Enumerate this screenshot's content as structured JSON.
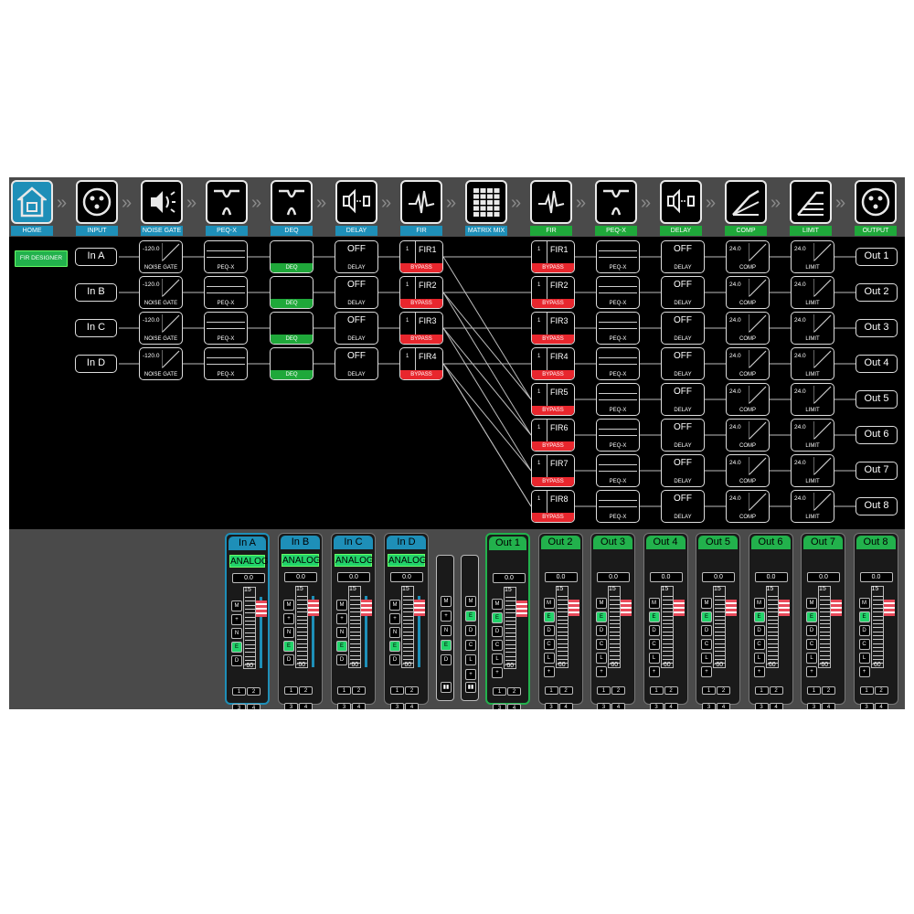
{
  "toolbar": {
    "items": [
      {
        "label": "HOME",
        "icon": "home-icon",
        "color": "blue"
      },
      {
        "label": "INPUT",
        "icon": "xlr-input-icon",
        "color": "blue"
      },
      {
        "label": "NOISE GATE",
        "icon": "speaker-icon",
        "color": "blue"
      },
      {
        "label": "PEQ-X",
        "icon": "peq-x-icon",
        "color": "blue"
      },
      {
        "label": "DEQ",
        "icon": "deq-icon",
        "color": "blue"
      },
      {
        "label": "DELAY",
        "icon": "delay-icon",
        "color": "blue"
      },
      {
        "label": "FIR",
        "icon": "fir-icon",
        "color": "blue"
      },
      {
        "label": "MATRIX MIX",
        "icon": "matrix-icon",
        "color": "blue"
      },
      {
        "label": "FIR",
        "icon": "fir-icon",
        "color": "green"
      },
      {
        "label": "PEQ-X",
        "icon": "peq-x-icon",
        "color": "green"
      },
      {
        "label": "DELAY",
        "icon": "delay-icon",
        "color": "green"
      },
      {
        "label": "COMP",
        "icon": "comp-icon",
        "color": "green"
      },
      {
        "label": "LIMIT",
        "icon": "limit-icon",
        "color": "green"
      },
      {
        "label": "OUTPUT",
        "icon": "xlr-output-icon",
        "color": "green"
      }
    ]
  },
  "fir_designer": "FIR DESIGNER",
  "inputs": [
    {
      "name": "In A",
      "gate": "-120.0",
      "gate_label": "NOISE GATE",
      "peq_label": "PEQ-X",
      "deq_label": "DEQ",
      "delay": "OFF",
      "delay_label": "DELAY",
      "fir": "FIR1",
      "fir_num": "1",
      "fir_label": "BYPASS"
    },
    {
      "name": "In B",
      "gate": "-120.0",
      "gate_label": "NOISE GATE",
      "peq_label": "PEQ-X",
      "deq_label": "DEQ",
      "delay": "OFF",
      "delay_label": "DELAY",
      "fir": "FIR2",
      "fir_num": "1",
      "fir_label": "BYPASS"
    },
    {
      "name": "In C",
      "gate": "-120.0",
      "gate_label": "NOISE GATE",
      "peq_label": "PEQ-X",
      "deq_label": "DEQ",
      "delay": "OFF",
      "delay_label": "DELAY",
      "fir": "FIR3",
      "fir_num": "1",
      "fir_label": "BYPASS"
    },
    {
      "name": "In D",
      "gate": "-120.0",
      "gate_label": "NOISE GATE",
      "peq_label": "PEQ-X",
      "deq_label": "DEQ",
      "delay": "OFF",
      "delay_label": "DELAY",
      "fir": "FIR4",
      "fir_num": "1",
      "fir_label": "BYPASS"
    }
  ],
  "outputs": [
    {
      "name": "Out 1",
      "fir": "FIR1",
      "fir_num": "1",
      "fir_label": "BYPASS",
      "peq_label": "PEQ-X",
      "delay": "OFF",
      "delay_label": "DELAY",
      "comp": "24.0",
      "comp_label": "COMP",
      "limit": "24.0",
      "limit_label": "LIMIT"
    },
    {
      "name": "Out 2",
      "fir": "FIR2",
      "fir_num": "1",
      "fir_label": "BYPASS",
      "peq_label": "PEQ-X",
      "delay": "OFF",
      "delay_label": "DELAY",
      "comp": "24.0",
      "comp_label": "COMP",
      "limit": "24.0",
      "limit_label": "LIMIT"
    },
    {
      "name": "Out 3",
      "fir": "FIR3",
      "fir_num": "1",
      "fir_label": "BYPASS",
      "peq_label": "PEQ-X",
      "delay": "OFF",
      "delay_label": "DELAY",
      "comp": "24.0",
      "comp_label": "COMP",
      "limit": "24.0",
      "limit_label": "LIMIT"
    },
    {
      "name": "Out 4",
      "fir": "FIR4",
      "fir_num": "1",
      "fir_label": "BYPASS",
      "peq_label": "PEQ-X",
      "delay": "OFF",
      "delay_label": "DELAY",
      "comp": "24.0",
      "comp_label": "COMP",
      "limit": "24.0",
      "limit_label": "LIMIT"
    },
    {
      "name": "Out 5",
      "fir": "FIR5",
      "fir_num": "1",
      "fir_label": "BYPASS",
      "peq_label": "PEQ-X",
      "delay": "OFF",
      "delay_label": "DELAY",
      "comp": "24.0",
      "comp_label": "COMP",
      "limit": "24.0",
      "limit_label": "LIMIT"
    },
    {
      "name": "Out 6",
      "fir": "FIR6",
      "fir_num": "1",
      "fir_label": "BYPASS",
      "peq_label": "PEQ-X",
      "delay": "OFF",
      "delay_label": "DELAY",
      "comp": "24.0",
      "comp_label": "COMP",
      "limit": "24.0",
      "limit_label": "LIMIT"
    },
    {
      "name": "Out 7",
      "fir": "FIR7",
      "fir_num": "1",
      "fir_label": "BYPASS",
      "peq_label": "PEQ-X",
      "delay": "OFF",
      "delay_label": "DELAY",
      "comp": "24.0",
      "comp_label": "COMP",
      "limit": "24.0",
      "limit_label": "LIMIT"
    },
    {
      "name": "Out 8",
      "fir": "FIR8",
      "fir_num": "1",
      "fir_label": "BYPASS",
      "peq_label": "PEQ-X",
      "delay": "OFF",
      "delay_label": "DELAY",
      "comp": "24.0",
      "comp_label": "COMP",
      "limit": "24.0",
      "limit_label": "LIMIT"
    }
  ],
  "mixer": {
    "input_strips": [
      {
        "name": "In A",
        "source": "ANALOG",
        "gain": "0.0",
        "scale_top": "15",
        "scale_bottom": "-60",
        "buttons": [
          "M",
          "+",
          "N",
          "E",
          "D"
        ],
        "active": [
          "E"
        ],
        "channels": [
          "1",
          "2",
          "3",
          "4"
        ],
        "selected": true
      },
      {
        "name": "In B",
        "source": "ANALOG",
        "gain": "0.0",
        "scale_top": "15",
        "scale_bottom": "-60",
        "buttons": [
          "M",
          "+",
          "N",
          "E",
          "D"
        ],
        "active": [
          "E"
        ],
        "channels": [
          "1",
          "2",
          "3",
          "4"
        ],
        "selected": false
      },
      {
        "name": "In C",
        "source": "ANALOG",
        "gain": "0.0",
        "scale_top": "15",
        "scale_bottom": "-60",
        "buttons": [
          "M",
          "+",
          "N",
          "E",
          "D"
        ],
        "active": [
          "E"
        ],
        "channels": [
          "1",
          "2",
          "3",
          "4"
        ],
        "selected": false
      },
      {
        "name": "In D",
        "source": "ANALOG",
        "gain": "0.0",
        "scale_top": "15",
        "scale_bottom": "-60",
        "buttons": [
          "M",
          "+",
          "N",
          "E",
          "D"
        ],
        "active": [
          "E"
        ],
        "channels": [
          "1",
          "2",
          "3",
          "4"
        ],
        "selected": false
      }
    ],
    "link_in": {
      "buttons": [
        "M",
        "+",
        "N",
        "E",
        "D"
      ],
      "active": [
        "E"
      ]
    },
    "link_out": {
      "buttons": [
        "M",
        "E",
        "D",
        "C",
        "L",
        "+"
      ],
      "active": [
        "E"
      ]
    },
    "output_strips": [
      {
        "name": "Out 1",
        "gain": "0.0",
        "scale_top": "15",
        "scale_bottom": "-60",
        "buttons": [
          "M",
          "E",
          "D",
          "C",
          "L",
          "+"
        ],
        "active": [
          "E"
        ],
        "channels": [
          "1",
          "2",
          "3",
          "4"
        ],
        "selected": true
      },
      {
        "name": "Out 2",
        "gain": "0.0",
        "scale_top": "15",
        "scale_bottom": "-60",
        "buttons": [
          "M",
          "E",
          "D",
          "C",
          "L",
          "+"
        ],
        "active": [
          "E"
        ],
        "channels": [
          "1",
          "2",
          "3",
          "4"
        ],
        "selected": false
      },
      {
        "name": "Out 3",
        "gain": "0.0",
        "scale_top": "15",
        "scale_bottom": "-60",
        "buttons": [
          "M",
          "E",
          "D",
          "C",
          "L",
          "+"
        ],
        "active": [
          "E"
        ],
        "channels": [
          "1",
          "2",
          "3",
          "4"
        ],
        "selected": false
      },
      {
        "name": "Out 4",
        "gain": "0.0",
        "scale_top": "15",
        "scale_bottom": "-60",
        "buttons": [
          "M",
          "E",
          "D",
          "C",
          "L",
          "+"
        ],
        "active": [
          "E"
        ],
        "channels": [
          "1",
          "2",
          "3",
          "4"
        ],
        "selected": false
      },
      {
        "name": "Out 5",
        "gain": "0.0",
        "scale_top": "15",
        "scale_bottom": "-60",
        "buttons": [
          "M",
          "E",
          "D",
          "C",
          "L",
          "+"
        ],
        "active": [
          "E"
        ],
        "channels": [
          "1",
          "2",
          "3",
          "4"
        ],
        "selected": false
      },
      {
        "name": "Out 6",
        "gain": "0.0",
        "scale_top": "15",
        "scale_bottom": "-60",
        "buttons": [
          "M",
          "E",
          "D",
          "C",
          "L",
          "+"
        ],
        "active": [
          "E"
        ],
        "channels": [
          "1",
          "2",
          "3",
          "4"
        ],
        "selected": false
      },
      {
        "name": "Out 7",
        "gain": "0.0",
        "scale_top": "15",
        "scale_bottom": "-60",
        "buttons": [
          "M",
          "E",
          "D",
          "C",
          "L",
          "+"
        ],
        "active": [
          "E"
        ],
        "channels": [
          "1",
          "2",
          "3",
          "4"
        ],
        "selected": false
      },
      {
        "name": "Out 8",
        "gain": "0.0",
        "scale_top": "15",
        "scale_bottom": "-60",
        "buttons": [
          "M",
          "E",
          "D",
          "C",
          "L",
          "+"
        ],
        "active": [
          "E"
        ],
        "channels": [
          "1",
          "2",
          "3",
          "4"
        ],
        "selected": false
      }
    ]
  },
  "colors": {
    "accent_blue": "#1e8fb8",
    "accent_green": "#22b14c",
    "bypass_red": "#e8262d",
    "background": "#000000",
    "panel": "#4a4a4a"
  }
}
